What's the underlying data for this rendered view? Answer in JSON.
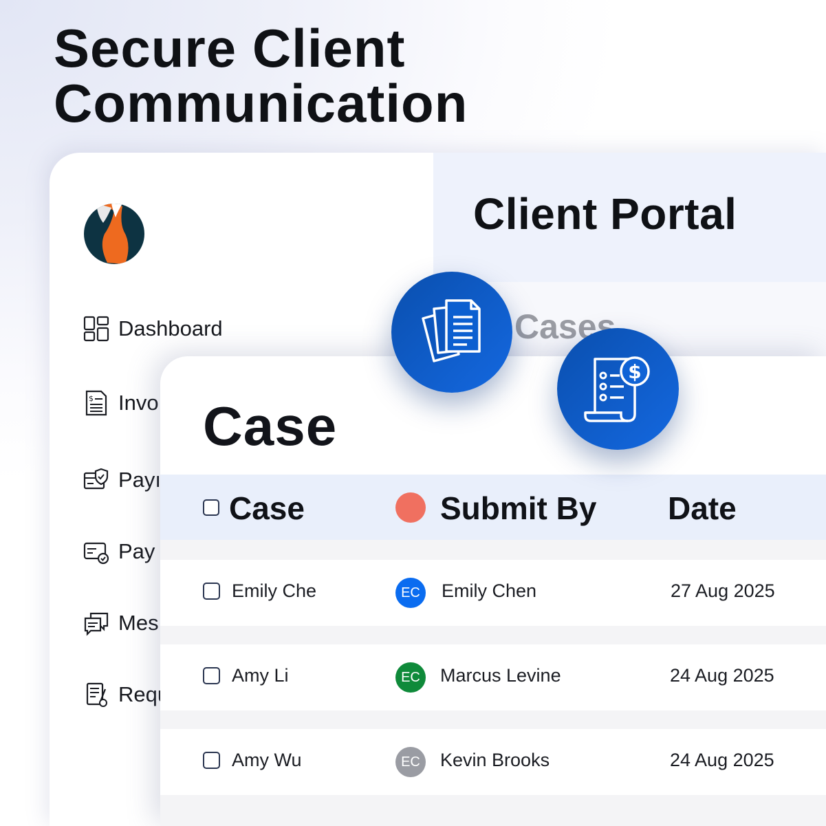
{
  "headline": {
    "line1": "Secure Client",
    "line2": "Communication"
  },
  "portal": {
    "title": "Client Portal",
    "cases_label": "Cases",
    "sidebar": [
      {
        "label": "Dashboard",
        "icon": "dashboard-icon"
      },
      {
        "label": "Invo",
        "icon": "invoice-icon"
      },
      {
        "label": "Payı",
        "icon": "payment-shield-icon"
      },
      {
        "label": "Pay",
        "icon": "card-check-icon"
      },
      {
        "label": "Mes",
        "icon": "messages-icon"
      },
      {
        "label": "Requ",
        "icon": "request-form-icon"
      }
    ]
  },
  "case_card": {
    "title": "Case",
    "columns": {
      "case": "Case",
      "submit_by": "Submit By",
      "date": "Date"
    },
    "header_dot_color": "#f07060",
    "rows": [
      {
        "case": "Emily Che",
        "avatar": "EC",
        "avatar_color": "#0a6cf0",
        "submit_by": "Emily Chen",
        "date": "27 Aug 2025"
      },
      {
        "case": "Amy Li",
        "avatar": "EC",
        "avatar_color": "#0f8a3a",
        "submit_by": "Marcus Levine",
        "date": "24 Aug 2025"
      },
      {
        "case": "Amy Wu",
        "avatar": "EC",
        "avatar_color": "#9a9ca3",
        "submit_by": "Kevin Brooks",
        "date": "24 Aug 2025"
      }
    ]
  },
  "badges": [
    {
      "icon": "documents-icon"
    },
    {
      "icon": "receipt-dollar-icon"
    }
  ],
  "colors": {
    "brand_blue": "#0a4fae",
    "logo_bg": "#0d3342",
    "logo_orange": "#ee6a1f"
  }
}
